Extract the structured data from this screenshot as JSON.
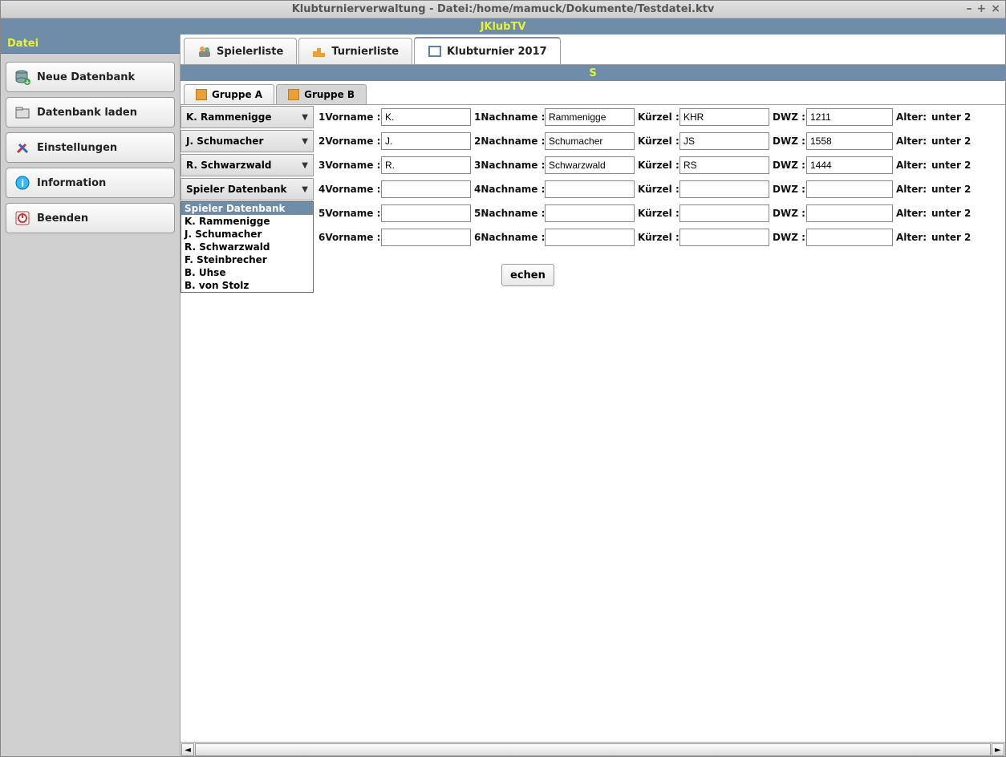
{
  "window": {
    "title": "Klubturnierverwaltung - Datei:/home/mamuck/Dokumente/Testdatei.ktv"
  },
  "appheader": "JKlubTV",
  "sidebar": {
    "title": "Datei",
    "items": [
      {
        "label": "Neue Datenbank",
        "icon": "database-new-icon"
      },
      {
        "label": "Datenbank laden",
        "icon": "folder-open-icon"
      },
      {
        "label": "Einstellungen",
        "icon": "tools-icon"
      },
      {
        "label": "Information",
        "icon": "info-icon"
      },
      {
        "label": "Beenden",
        "icon": "power-icon"
      }
    ]
  },
  "tabs_primary": [
    {
      "label": "Spielerliste",
      "icon": "players-icon"
    },
    {
      "label": "Turnierliste",
      "icon": "podium-icon"
    },
    {
      "label": "Klubturnier 2017",
      "icon": "square-icon",
      "active": true
    }
  ],
  "section_label": "S",
  "tabs_secondary": [
    {
      "label": "Gruppe A"
    },
    {
      "label": "Gruppe B",
      "active": true
    }
  ],
  "labels": {
    "vorname_prefix": "Vorname :",
    "nachname_prefix": "Nachname :",
    "kuerzel": "Kürzel :",
    "dwz": "DWZ :",
    "alter": "Alter:",
    "alter_value": "unter 2"
  },
  "rows": [
    {
      "combo": "K. Rammenigge",
      "vorname": "K.",
      "nachname": "Rammenigge",
      "kuerzel": "KHR",
      "dwz": "1211"
    },
    {
      "combo": "J. Schumacher",
      "vorname": "J.",
      "nachname": "Schumacher",
      "kuerzel": "JS",
      "dwz": "1558"
    },
    {
      "combo": "R. Schwarzwald",
      "vorname": "R.",
      "nachname": "Schwarzwald",
      "kuerzel": "RS",
      "dwz": "1444"
    },
    {
      "combo": "Spieler Datenbank",
      "vorname": "",
      "nachname": "",
      "kuerzel": "",
      "dwz": "",
      "open": true
    },
    {
      "combo": "",
      "vorname": "",
      "nachname": "",
      "kuerzel": "",
      "dwz": "",
      "hide_combo": true
    },
    {
      "combo": "",
      "vorname": "",
      "nachname": "",
      "kuerzel": "",
      "dwz": "",
      "hide_combo": true
    }
  ],
  "dropdown": {
    "selected": "Spieler Datenbank",
    "options": [
      "Spieler Datenbank",
      "K. Rammenigge",
      "J. Schumacher",
      "R. Schwarzwald",
      "F. Steinbrecher",
      "B. Uhse",
      "B. von Stolz"
    ]
  },
  "partial_button": "echen"
}
